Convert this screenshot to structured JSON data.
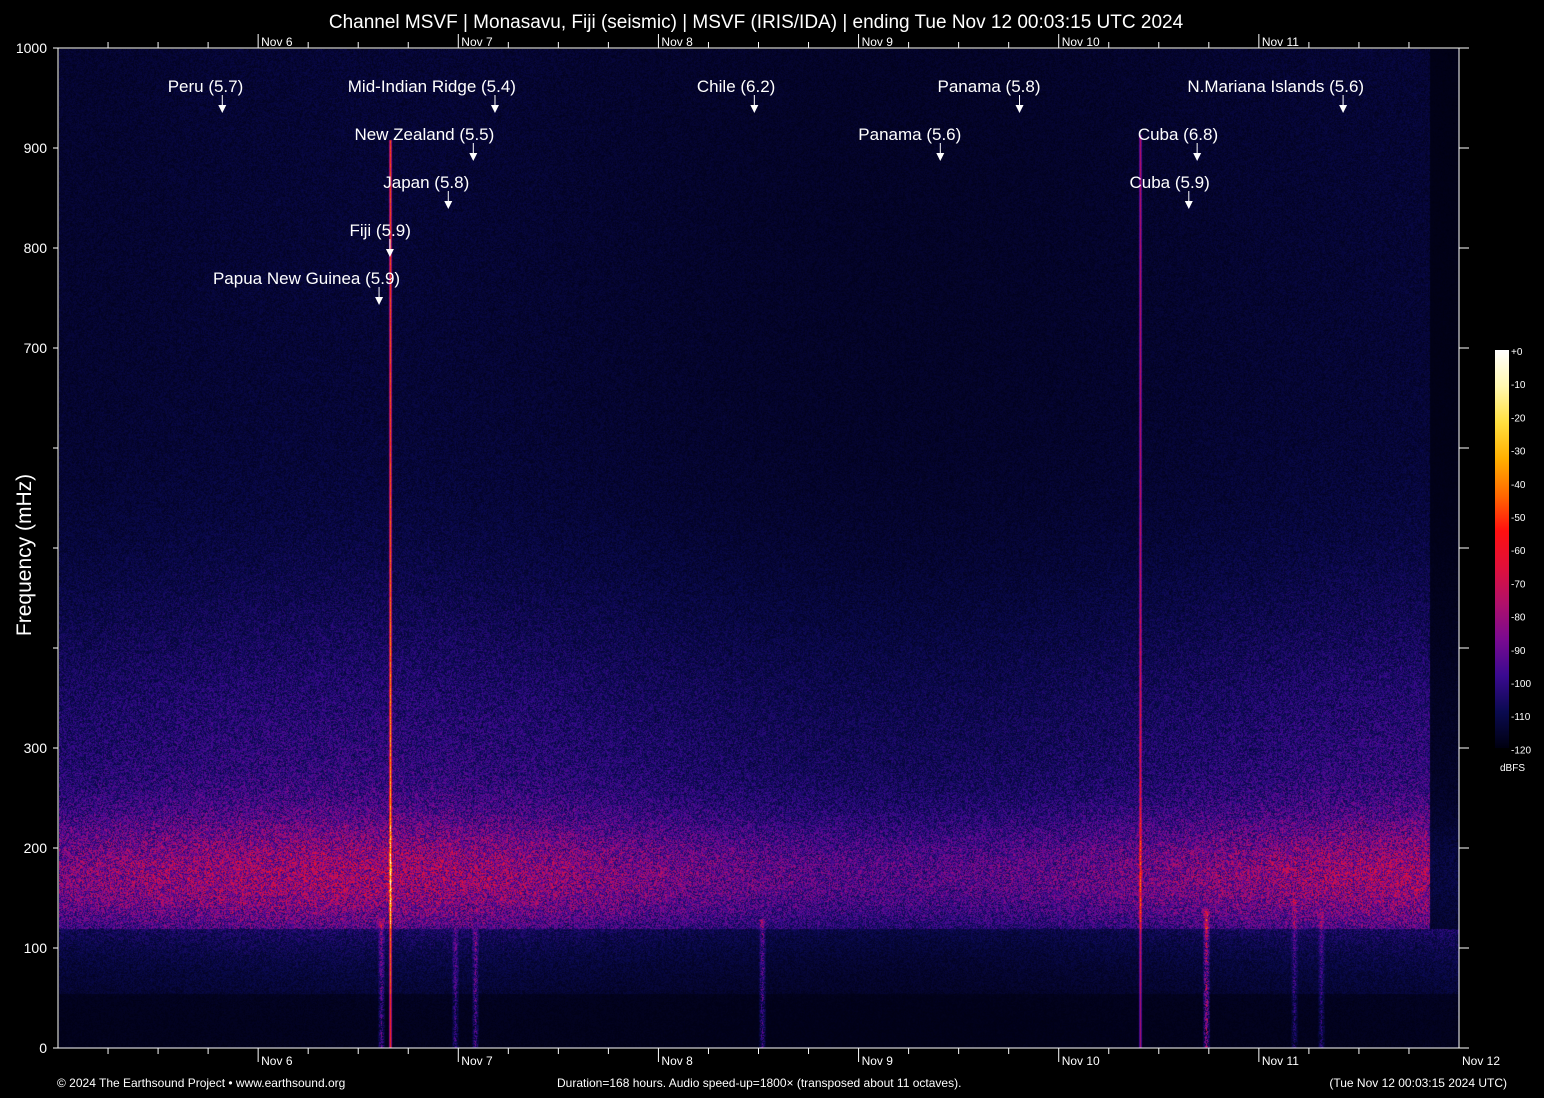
{
  "chart_data": {
    "type": "heatmap",
    "title": "Channel MSVF | Monasavu, Fiji (seismic) | MSVF (IRIS/IDA) | ending Tue Nov 12 00:03:15 UTC 2024",
    "ylabel": "Frequency (mHz)",
    "xlabel": "",
    "ylim": [
      0,
      1000
    ],
    "xlim_hours": [
      0,
      168
    ],
    "ytick_values": [
      0,
      100,
      200,
      300,
      400,
      500,
      600,
      700,
      800,
      900,
      1000
    ],
    "ytick_labels": [
      "0",
      "100",
      "200",
      "300",
      "",
      "",
      "",
      "700",
      "800",
      "900",
      "1000"
    ],
    "xticks": [
      {
        "label": "Nov  6",
        "hours": 24
      },
      {
        "label": "Nov  7",
        "hours": 48
      },
      {
        "label": "Nov  8",
        "hours": 72
      },
      {
        "label": "Nov  9",
        "hours": 96
      },
      {
        "label": "Nov 10",
        "hours": 120
      },
      {
        "label": "Nov 11",
        "hours": 144
      }
    ],
    "end_label": "Nov 12",
    "colorbar": {
      "label": "dBFS",
      "ticks": [
        "+0",
        "-10",
        "-20",
        "-30",
        "-40",
        "-50",
        "-60",
        "-70",
        "-80",
        "-90",
        "-100",
        "-110",
        "-120"
      ],
      "range": [
        -120,
        0
      ],
      "colors": [
        "#000010",
        "#0a0a50",
        "#3a0a90",
        "#7a0a90",
        "#b0106a",
        "#e0103a",
        "#ff1010",
        "#ff6a00",
        "#ffb000",
        "#ffe040",
        "#fff8b0",
        "#ffffff"
      ]
    },
    "events": [
      {
        "label": "Peru (5.7)",
        "hours": 19.7
      },
      {
        "label": "Mid-Indian Ridge (5.4)",
        "hours": 52.4
      },
      {
        "label": "Chile (6.2)",
        "hours": 83.5
      },
      {
        "label": "Panama (5.8)",
        "hours": 115.3
      },
      {
        "label": "N.Mariana Islands (5.6)",
        "hours": 154.1
      },
      {
        "label": "New Zealand (5.5)",
        "hours": 49.8
      },
      {
        "label": "Panama (5.6)",
        "hours": 105.8
      },
      {
        "label": "Cuba (6.8)",
        "hours": 136.6
      },
      {
        "label": "Japan (5.8)",
        "hours": 46.8
      },
      {
        "label": "Cuba (5.9)",
        "hours": 135.6
      },
      {
        "label": "Fiji (5.9)",
        "hours": 39.8
      },
      {
        "label": "Papua New Guinea (5.9)",
        "hours": 38.5
      }
    ]
  },
  "footer": {
    "copyright": "© 2024 The Earthsound Project • www.earthsound.org",
    "duration": "Duration=168 hours. Audio speed-up=1800× (transposed about 11 octaves).",
    "timestamp": "(Tue Nov 12 00:03:15 2024 UTC)"
  }
}
